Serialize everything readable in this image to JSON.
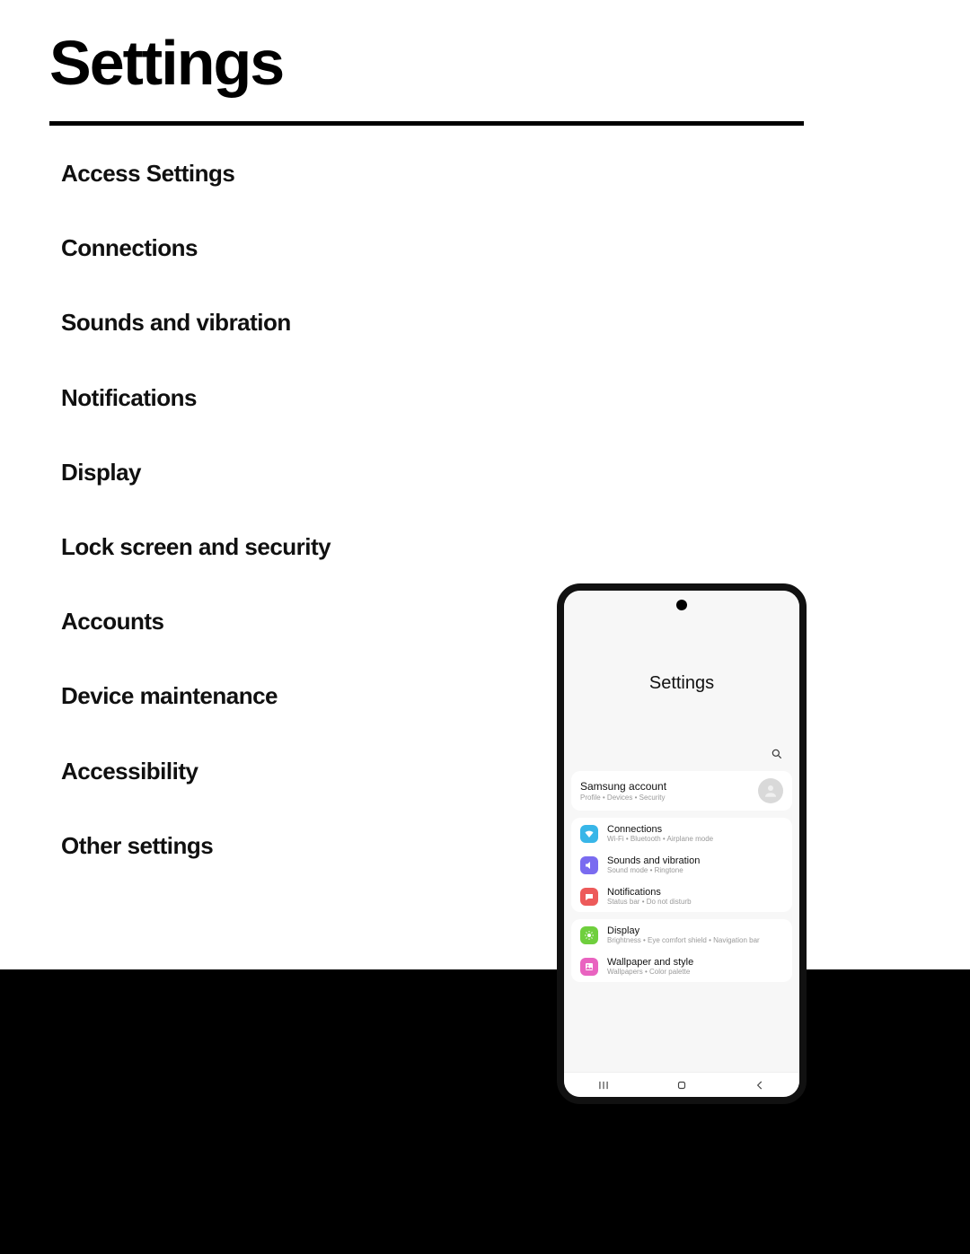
{
  "page": {
    "title": "Settings"
  },
  "toc": [
    "Access Settings",
    "Connections",
    "Sounds and vibration",
    "Notifications",
    "Display",
    "Lock screen and security",
    "Accounts",
    "Device maintenance",
    "Accessibility",
    "Other settings"
  ],
  "phone": {
    "title": "Settings",
    "account": {
      "title": "Samsung account",
      "sub": "Profile  •  Devices  •  Security"
    },
    "group1": [
      {
        "title": "Connections",
        "sub": "Wi-Fi  •  Bluetooth  •  Airplane mode",
        "color": "#38b6e8",
        "icon": "wifi"
      },
      {
        "title": "Sounds and vibration",
        "sub": "Sound mode  •  Ringtone",
        "color": "#7a6bf0",
        "icon": "sound"
      },
      {
        "title": "Notifications",
        "sub": "Status bar  •  Do not disturb",
        "color": "#ed5a5a",
        "icon": "notif"
      }
    ],
    "group2": [
      {
        "title": "Display",
        "sub": "Brightness  •  Eye comfort shield  •  Navigation bar",
        "color": "#6fcf3d",
        "icon": "display"
      },
      {
        "title": "Wallpaper and style",
        "sub": "Wallpapers  •  Color palette",
        "color": "#e963c0",
        "icon": "wallpaper"
      }
    ]
  }
}
